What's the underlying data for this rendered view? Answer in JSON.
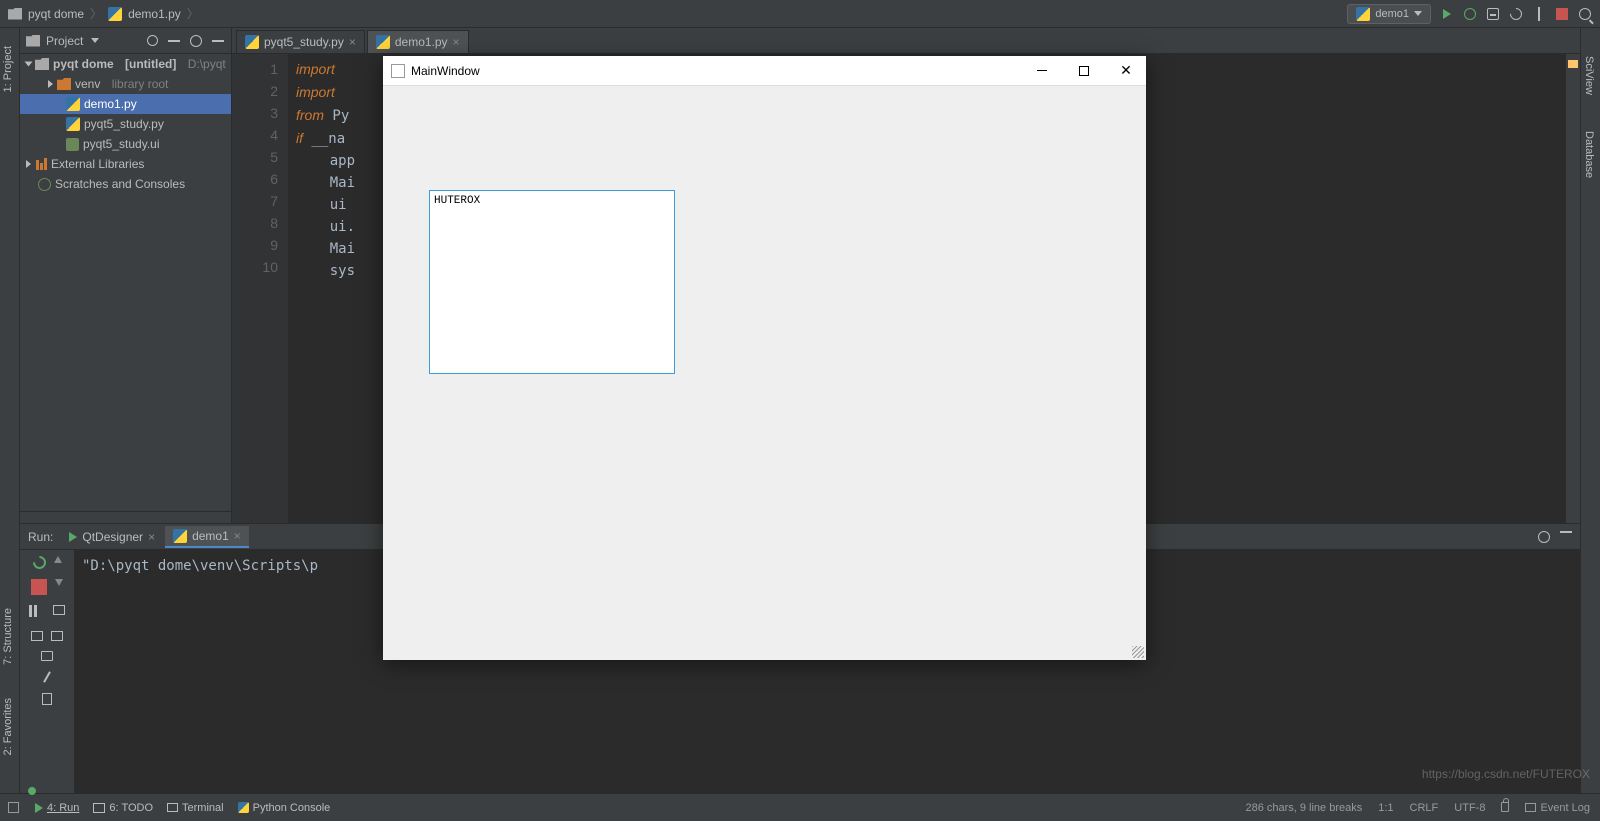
{
  "nav": {
    "project_name": "pyqt dome",
    "current_file": "demo1.py"
  },
  "toolbar": {
    "run_config": "demo1"
  },
  "left_rail": {
    "project": "1: Project",
    "structure": "7: Structure",
    "favorites": "2: Favorites"
  },
  "right_rail": {
    "sciview": "SciView",
    "database": "Database"
  },
  "project_panel": {
    "title": "Project",
    "root": {
      "name": "pyqt dome",
      "tag": "[untitled]",
      "path": "D:\\pyqt"
    },
    "venv": {
      "name": "venv",
      "note": "library root"
    },
    "files": [
      "demo1.py",
      "pyqt5_study.py",
      "pyqt5_study.ui"
    ],
    "ext_lib": "External Libraries",
    "scratches": "Scratches and Consoles"
  },
  "tabs": [
    {
      "label": "pyqt5_study.py",
      "active": false
    },
    {
      "label": "demo1.py",
      "active": true
    }
  ],
  "code": {
    "lines": [
      {
        "n": 1,
        "pre": "",
        "kw": "import",
        "rest": " "
      },
      {
        "n": 2,
        "pre": "",
        "kw": "import",
        "rest": " "
      },
      {
        "n": 3,
        "pre": "",
        "kw": "from",
        "rest": " Py"
      },
      {
        "n": 4,
        "pre": "",
        "kw": "if",
        "rest": " __na"
      },
      {
        "n": 5,
        "pre": "    ",
        "kw": "",
        "rest": "app"
      },
      {
        "n": 6,
        "pre": "    ",
        "kw": "",
        "rest": "Mai"
      },
      {
        "n": 7,
        "pre": "    ",
        "kw": "",
        "rest": "ui "
      },
      {
        "n": 8,
        "pre": "    ",
        "kw": "",
        "rest": "ui."
      },
      {
        "n": 9,
        "pre": "    ",
        "kw": "",
        "rest": "Mai"
      },
      {
        "n": 10,
        "pre": "    ",
        "kw": "",
        "rest": "sys"
      }
    ]
  },
  "run": {
    "label": "Run:",
    "tab_qt": "QtDesigner",
    "tab_demo": "demo1",
    "console_line": "\"D:\\pyqt dome\\venv\\Scripts\\p"
  },
  "status": {
    "run": "4: Run",
    "todo": "6: TODO",
    "terminal": "Terminal",
    "pyconsole": "Python Console",
    "event_log": "Event Log",
    "chars": "286 chars, 9 line breaks",
    "pos": "1:1",
    "eol": "CRLF",
    "enc": "UTF-8"
  },
  "app_window": {
    "title": "MainWindow",
    "textbox_content": "HUTEROX"
  },
  "watermark": "https://blog.csdn.net/FUTEROX"
}
